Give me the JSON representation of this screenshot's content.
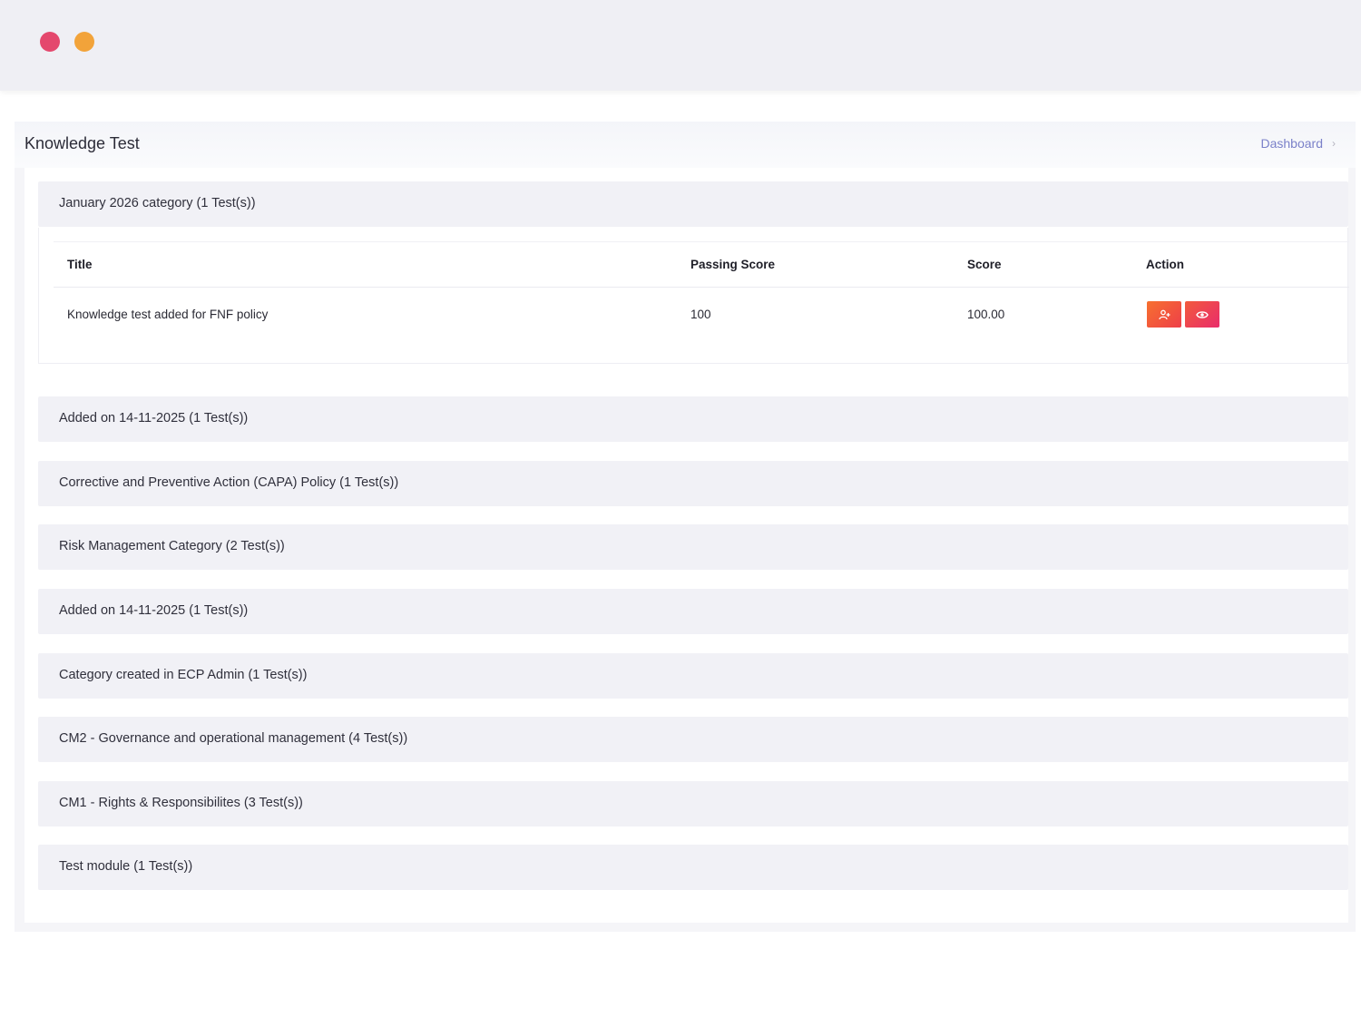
{
  "window": {
    "controls": [
      "close-dot",
      "minimize-dot"
    ],
    "colors": {
      "close": "#e4486d",
      "minimize": "#f2a33a"
    }
  },
  "page": {
    "title": "Knowledge Test",
    "breadcrumb": {
      "link": "Dashboard",
      "separator": "›"
    }
  },
  "table": {
    "columns": {
      "title": "Title",
      "passing_score": "Passing Score",
      "score": "Score",
      "action": "Action"
    },
    "rows": [
      {
        "title": "Knowledge test added for FNF policy",
        "passing_score": "100",
        "score": "100.00",
        "actions": [
          {
            "icon": "user-assign-icon"
          },
          {
            "icon": "eye-icon"
          }
        ]
      }
    ]
  },
  "categories": [
    {
      "label": "January 2026 category (1 Test(s))",
      "expanded": true
    },
    {
      "label": "Added on 14-11-2025 (1 Test(s))",
      "expanded": false
    },
    {
      "label": "Corrective and Preventive Action (CAPA) Policy (1 Test(s))",
      "expanded": false
    },
    {
      "label": "Risk Management Category (2 Test(s))",
      "expanded": false
    },
    {
      "label": "Added on 14-11-2025 (1 Test(s))",
      "expanded": false
    },
    {
      "label": "Category created in ECP Admin (1 Test(s))",
      "expanded": false
    },
    {
      "label": "CM2 - Governance and operational management (4 Test(s))",
      "expanded": false
    },
    {
      "label": "CM1 - Rights & Responsibilites (3 Test(s))",
      "expanded": false
    },
    {
      "label": "Test module (1 Test(s))",
      "expanded": false
    }
  ],
  "colors": {
    "accent": "#7b81c9",
    "action_orange": "#f7702f",
    "action_pink": "#e92c6b"
  }
}
